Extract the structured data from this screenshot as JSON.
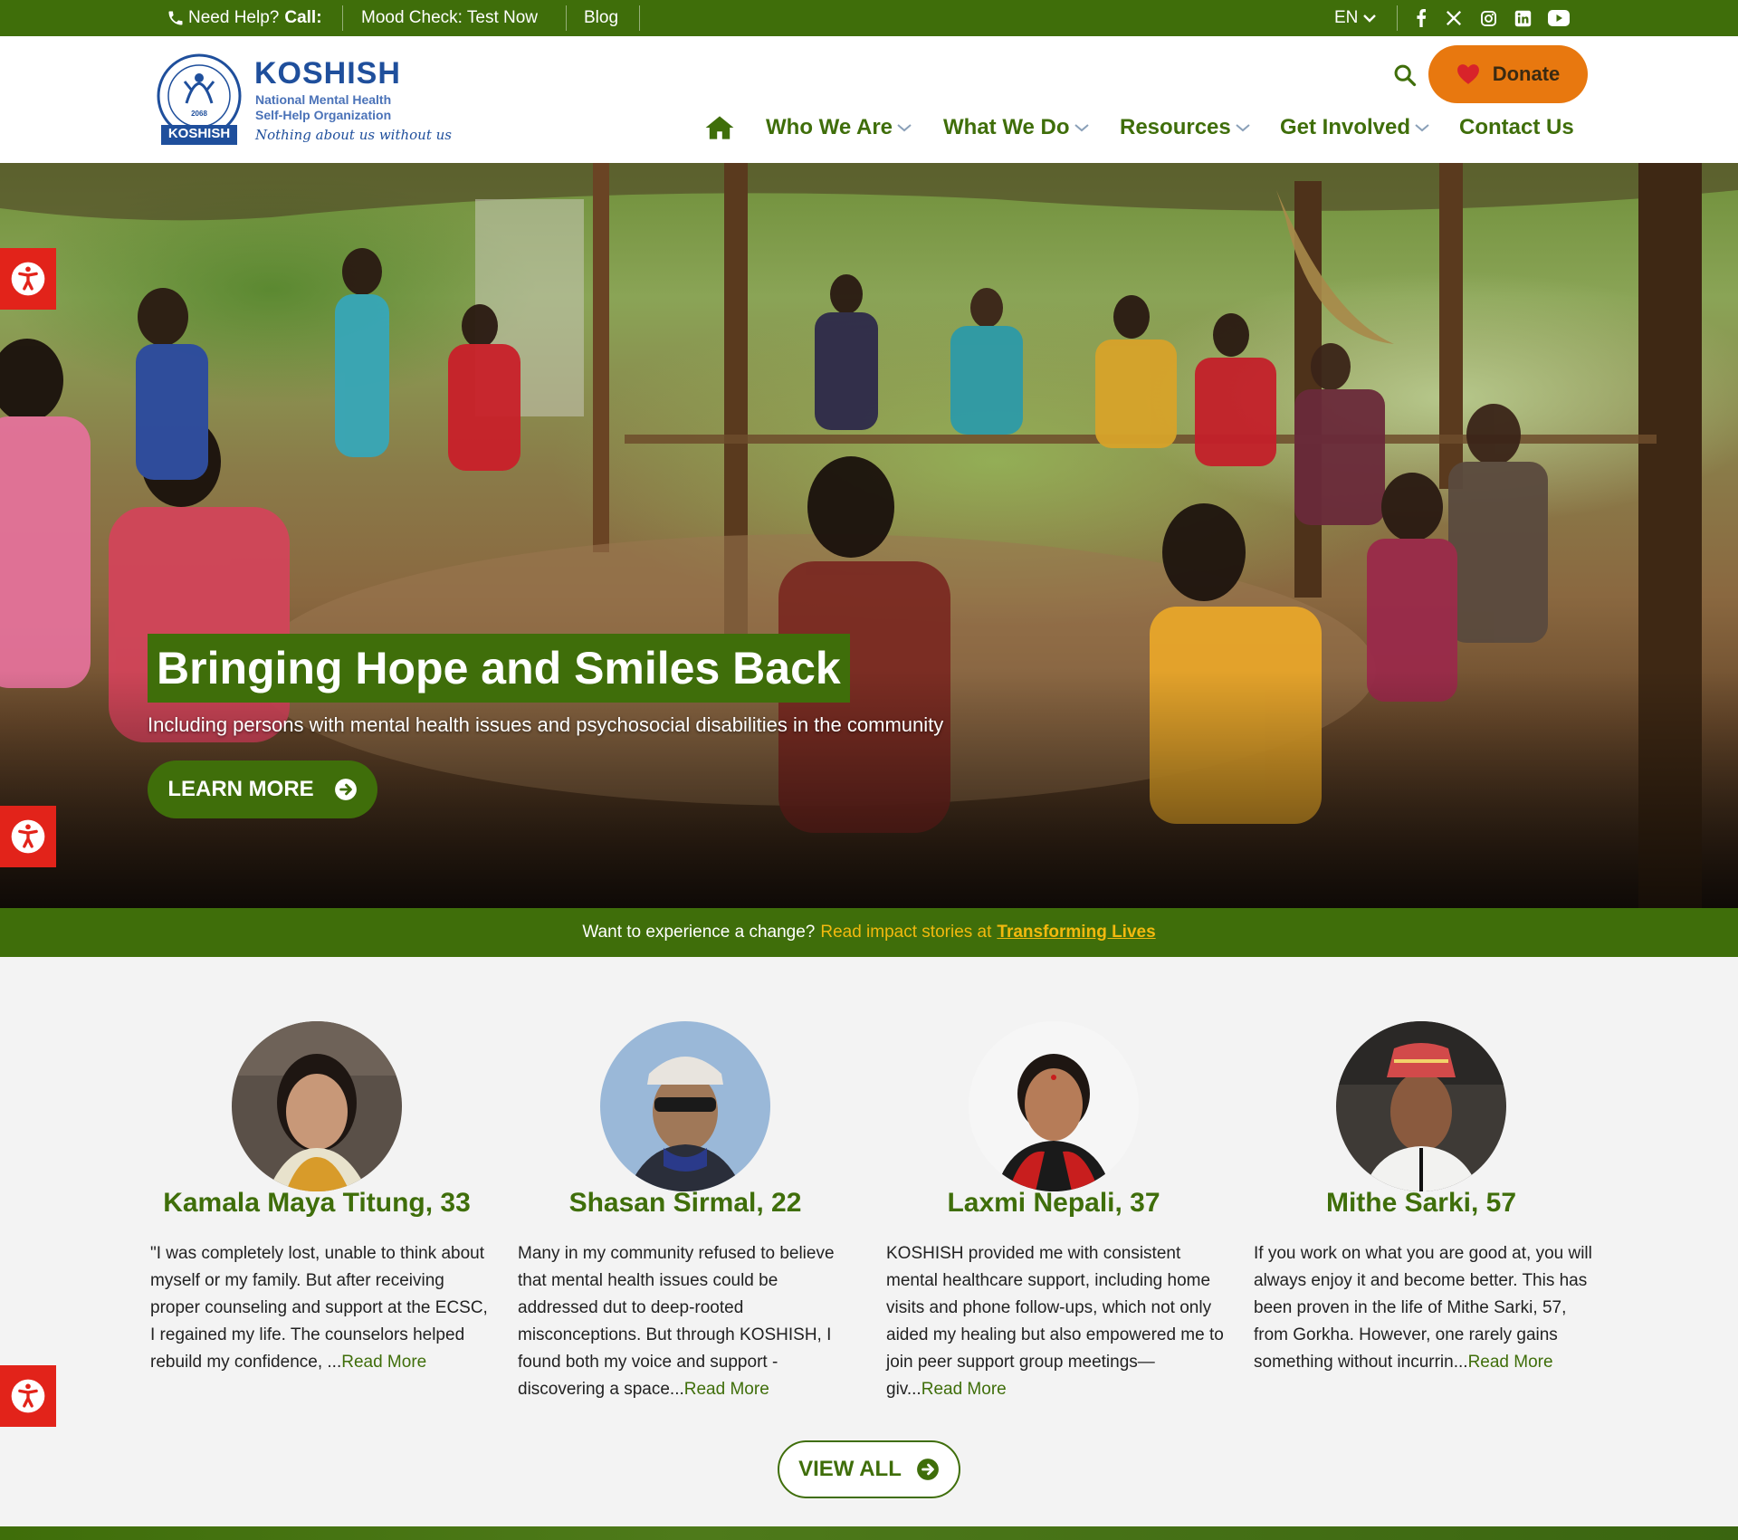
{
  "topbar": {
    "help_label": "Need Help?",
    "call_label": "Call:",
    "mood_check": "Mood Check: Test Now",
    "blog": "Blog",
    "language": "EN",
    "social_icons": [
      "facebook-icon",
      "x-icon",
      "instagram-icon",
      "linkedin-icon",
      "youtube-icon"
    ]
  },
  "brand": {
    "name": "KOSHISH",
    "subtitle_line1": "National Mental Health",
    "subtitle_line2": "Self-Help Organization",
    "tagline": "Nothing about us without us",
    "seal_label": "KOSHISH",
    "seal_year": "2068"
  },
  "header": {
    "donate_label": "Donate"
  },
  "nav": {
    "home_icon": "home-icon",
    "items": [
      {
        "label": "Who We Are",
        "has_dropdown": true
      },
      {
        "label": "What We Do",
        "has_dropdown": true
      },
      {
        "label": "Resources",
        "has_dropdown": true
      },
      {
        "label": "Get Involved",
        "has_dropdown": true
      },
      {
        "label": "Contact Us",
        "has_dropdown": false
      }
    ]
  },
  "hero": {
    "title": "Bringing Hope and Smiles Back",
    "subtitle": "Including persons with mental health issues and psychosocial disabilities in the community",
    "cta_label": "LEARN MORE"
  },
  "banner": {
    "text_white": "Want to experience a change?",
    "text_yellow": "Read impact stories at",
    "link_label": "Transforming Lives"
  },
  "stories": [
    {
      "name": "Kamala Maya Titung, 33",
      "excerpt": "\"I was completely lost, unable to think about myself or my family. But after receiving proper counseling and support at the ECSC, I regained my life. The counselors helped rebuild my confidence, ...",
      "more": "Read More"
    },
    {
      "name": "Shasan Sirmal, 22",
      "excerpt": "Many in my community refused to believe that mental health issues could be addressed dut to deep-rooted misconceptions. But through KOSHISH, I found both my voice and support - discovering a space...",
      "more": "Read More"
    },
    {
      "name": "Laxmi Nepali, 37",
      "excerpt": "KOSHISH provided me with consistent mental healthcare support, including home visits and phone follow-ups, which not only aided my healing but also empowered me to join peer support group meetings—giv...",
      "more": "Read More"
    },
    {
      "name": "Mithe Sarki, 57",
      "excerpt": "If you work on what you are good at, you will always enjoy it and become better. This has been proven in the life of Mithe Sarki, 57, from Gorkha. However, one rarely gains something without incurrin...",
      "more": "Read More"
    }
  ],
  "view_all_label": "VIEW ALL",
  "colors": {
    "brand_green": "#3f6e0a",
    "donate_orange": "#e8780f",
    "accent_yellow": "#f2b90f",
    "a11y_red": "#e2231a",
    "logo_blue": "#1f4f9c"
  }
}
